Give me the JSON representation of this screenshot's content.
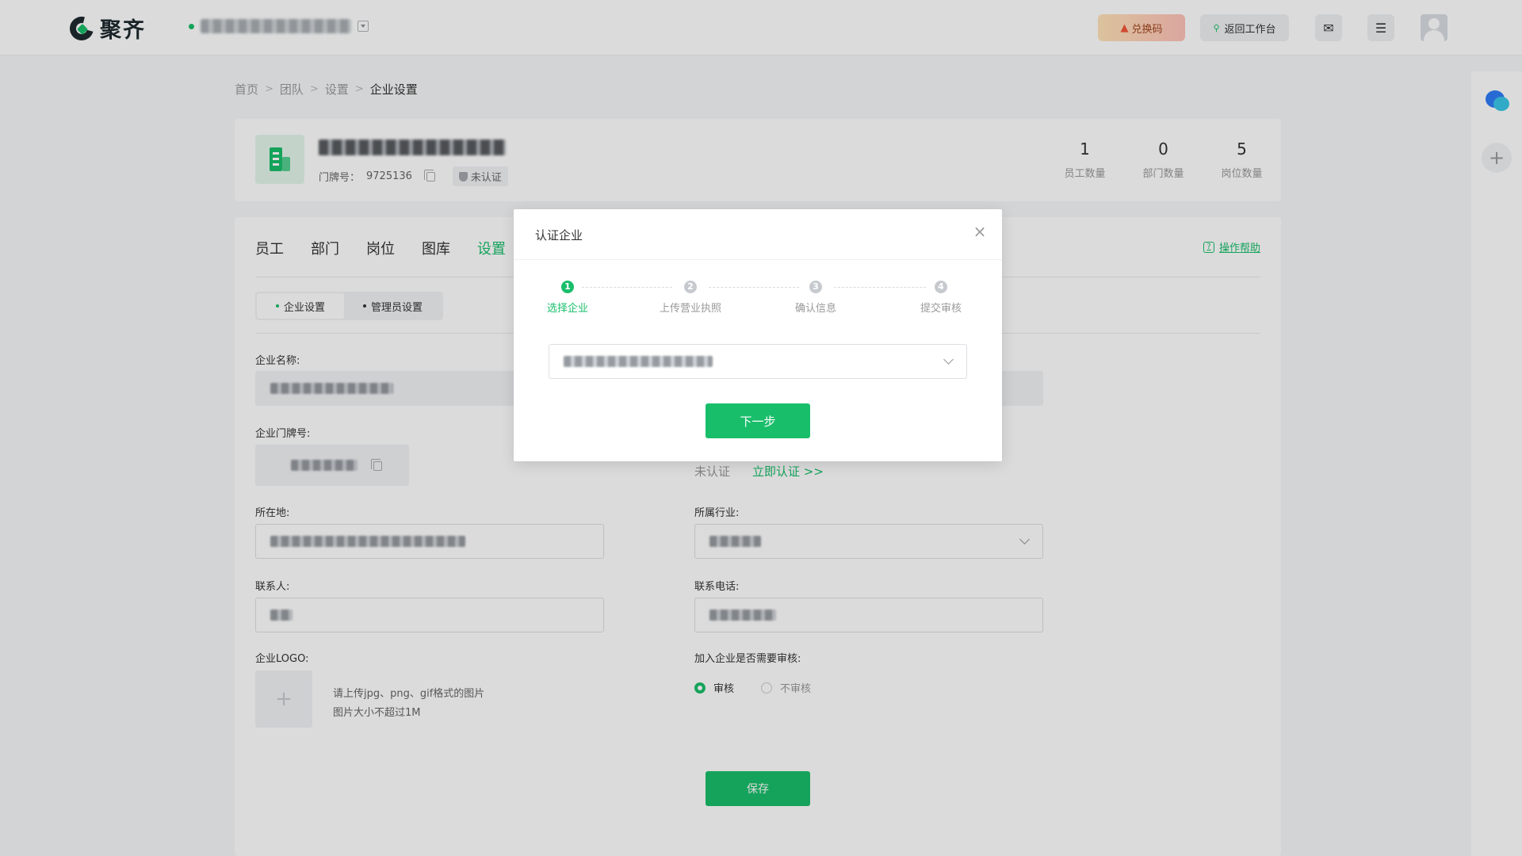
{
  "brand": {
    "name": "聚齐",
    "accent": "#19be6b"
  },
  "header": {
    "redeem_label": "兑换码",
    "workbench_label": "返回工作台"
  },
  "breadcrumb": [
    "首页",
    "团队",
    "设置",
    "企业设置"
  ],
  "company": {
    "door_no_label": "门牌号：",
    "door_no": "9725136",
    "cert_status": "未认证",
    "stats": [
      {
        "value": "1",
        "label": "员工数量"
      },
      {
        "value": "0",
        "label": "部门数量"
      },
      {
        "value": "5",
        "label": "岗位数量"
      }
    ]
  },
  "tabs": [
    "员工",
    "部门",
    "岗位",
    "图库",
    "设置"
  ],
  "active_tab": "设置",
  "help_label": "操作帮助",
  "subtabs": [
    "企业设置",
    "管理员设置"
  ],
  "form": {
    "name_label": "企业名称:",
    "door_label": "企业门牌号:",
    "location_label": "所在地:",
    "industry_label": "所属行业:",
    "contact_label": "联系人:",
    "phone_label": "联系电话:",
    "logo_label": "企业LOGO:",
    "upload_hint_1": "请上传jpg、png、gif格式的图片",
    "upload_hint_2": "图片大小不超过1M",
    "review_label": "加入企业是否需要审核:",
    "review_on": "审核",
    "review_off": "不审核",
    "cert_status": "未认证",
    "cert_link": "立即认证 >>",
    "save_label": "保存"
  },
  "modal": {
    "title": "认证企业",
    "steps": [
      {
        "num": "1",
        "label": "选择企业"
      },
      {
        "num": "2",
        "label": "上传营业执照"
      },
      {
        "num": "3",
        "label": "确认信息"
      },
      {
        "num": "4",
        "label": "提交审核"
      }
    ],
    "next_label": "下一步"
  }
}
